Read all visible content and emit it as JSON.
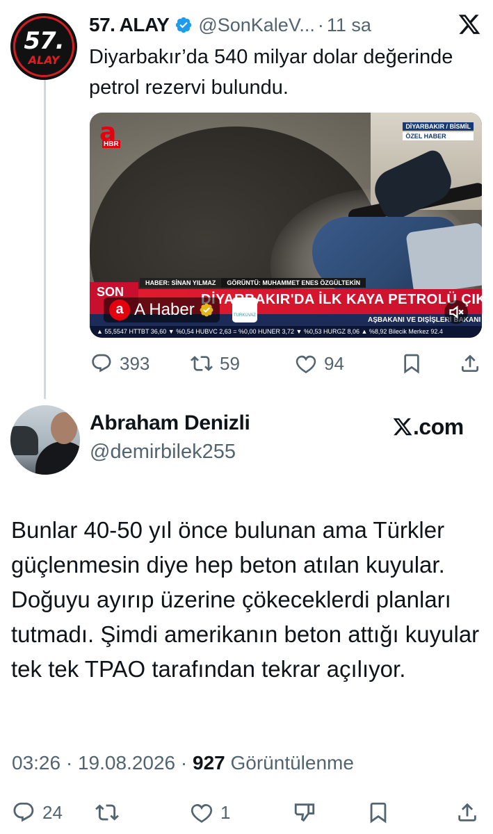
{
  "quoted_tweet": {
    "avatar_text": "57.",
    "avatar_subtext": "ALAY",
    "author_name": "57. ALAY",
    "handle": "@SonKaleV...",
    "separator": "·",
    "time_ago": "11 sa",
    "text": "Diyarbakır’da 540 milyar dolar değerinde petrol rezervi bulundu.",
    "media": {
      "logo_letter": "a",
      "logo_sub": "HBR",
      "location_line1": "DİYARBAKIR / BİSMİL",
      "location_line2": "ÖZEL HABER",
      "credit_reporter": "HABER: SİNAN YILMAZ",
      "credit_camera": "GÖRÜNTÜ: MUHAMMET ENES ÖZGÜLTEKİN",
      "breaking_label": "SON",
      "headline": "DİYARBAKIR'DA İLK KAYA PETROLÜ ÇIKARILIYOR",
      "ticker": "AŞBAKANI VE DIŞİŞLERİ BAKANI ŞEYH MUHAMMED BİN ABDURRAHMAN A",
      "market": "▲ 55,5547   HTTBT 36,60 ▼ %0,54   HUBVC 2,63 = %0,00   HUNER 3,72 ▼ %0,53   HURGZ 8,06 ▲ %8,92   Bilecik Merkez 92.4",
      "channel_letter": "a",
      "channel_name": "A Haber",
      "turkuvaz_label": "TURKUVAZ"
    },
    "stats": {
      "replies": "393",
      "reposts": "59",
      "likes": "94"
    }
  },
  "main_tweet": {
    "author_name": "Abraham Denizli",
    "handle": "@demirbilek255",
    "source_label": ".com",
    "text": "Bunlar 40-50 yıl önce bulunan ama Türkler güçlenmesin diye hep beton atılan kuyular. Doğuyu ayırıp üzerine çökeceklerdi planları tutmadı. Şimdi amerikanın beton attığı kuyular tek tek TPAO tarafından tekrar açılıyor.",
    "time": "03:26",
    "date": "19.08.2026",
    "separator": "·",
    "views_count": "927",
    "views_label": "Görüntülenme",
    "stats": {
      "replies": "24",
      "likes": "1"
    }
  },
  "icons": {
    "verified": "verified-badge-icon",
    "close": "x-logo-icon",
    "reply": "reply-icon",
    "repost": "repost-icon",
    "like": "like-icon",
    "bookmark": "bookmark-icon",
    "share": "share-icon",
    "dislike": "dislike-icon"
  },
  "colors": {
    "text_primary": "#0f1419",
    "text_secondary": "#536471",
    "verified_blue": "#1d9bf0",
    "thread_line": "#cfd9de",
    "news_red": "#c8102e"
  }
}
